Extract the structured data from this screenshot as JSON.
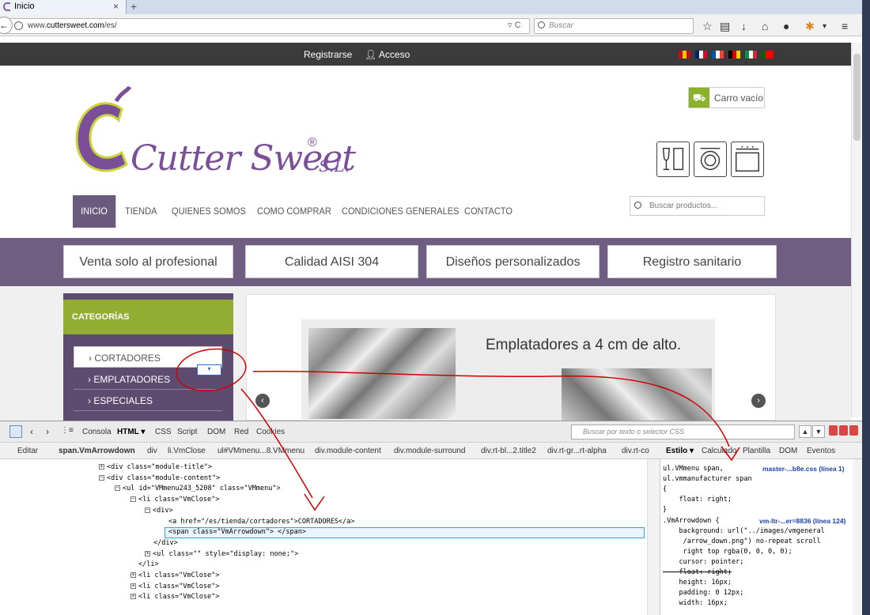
{
  "browser": {
    "tab_title": "Inicio",
    "tab_close": "×",
    "new_tab": "+",
    "url_prefix": "www.",
    "url_host": "cuttersweet.com",
    "url_path": "/es/",
    "search_placeholder": "Buscar",
    "toolbar_icons": [
      "star-icon",
      "clipboard-icon",
      "download-icon",
      "home-icon",
      "chat-icon",
      "extension-icon",
      "menu-icon"
    ]
  },
  "site": {
    "topbar": {
      "register": "Registrarse",
      "login": "Acceso"
    },
    "flags": [
      {
        "name": "spanish-flag",
        "colors": [
          "#c60b1e",
          "#ffc400",
          "#c60b1e"
        ]
      },
      {
        "name": "uk-flag",
        "colors": [
          "#012169",
          "#ffffff",
          "#c8102e"
        ]
      },
      {
        "name": "french-flag",
        "colors": [
          "#0055a4",
          "#ffffff",
          "#ef4135"
        ]
      },
      {
        "name": "german-flag",
        "colors": [
          "#000000",
          "#dd0000",
          "#ffce00"
        ]
      },
      {
        "name": "italian-flag",
        "colors": [
          "#009246",
          "#ffffff",
          "#ce2b37"
        ]
      },
      {
        "name": "portuguese-flag",
        "colors": [
          "#006600",
          "#ff0000",
          "#ff0000"
        ]
      }
    ],
    "logo": {
      "text": "Cutter Sweet",
      "registered": "®",
      "suffix": "S.L."
    },
    "cart": {
      "label": "Carro vacío"
    },
    "menu": [
      {
        "label": "INICIO",
        "active": true
      },
      {
        "label": "TIENDA"
      },
      {
        "label": "QUIENES SOMOS"
      },
      {
        "label": "COMO COMPRAR"
      },
      {
        "label": "CONDICIONES GENERALES"
      },
      {
        "label": "CONTACTO"
      }
    ],
    "product_search_placeholder": "Buscar productos...",
    "features": [
      "Venta solo al profesional",
      "Calidad AISI 304",
      "Diseños personalizados",
      "Registro sanitario"
    ],
    "categories": {
      "title": "CATEGORÍAS",
      "items": [
        "CORTADORES",
        "EMPLATADORES",
        "ESPECIALES"
      ],
      "arrow_label": "▾"
    },
    "slider": {
      "caption": "Emplatadores a 4 cm de alto.",
      "prev": "‹",
      "next": "›"
    },
    "colors": {
      "brand_purple": "#6f5d82",
      "accent_green": "#93ad32",
      "topbar": "#3b3b3b"
    }
  },
  "devtools": {
    "tabs": [
      "Consola",
      "HTML ▾",
      "CSS",
      "Script",
      "DOM",
      "Red",
      "Cookies"
    ],
    "active_tab": "HTML ▾",
    "search_placeholder": "Buscar por texto o selector CSS",
    "edit_label": "Editar",
    "breadcrumbs": [
      "span.VmArrowdown",
      "div",
      "li.VmClose",
      "ul#VMmenu...8.VMmenu",
      "div.module-content",
      "div.module-surround",
      "div.rt-bl...2.title2",
      "div.rt-gr...rt-alpha",
      "div.rt-co"
    ],
    "side_tabs": [
      "Estilo ▾",
      "Calculado",
      "Plantilla",
      "DOM",
      "Eventos"
    ],
    "html_lines": [
      {
        "indent": 125,
        "exp": "⊞",
        "text": "<div class=\"module-title\">"
      },
      {
        "indent": 125,
        "exp": "⊟",
        "text": "<div class=\"module-content\">"
      },
      {
        "indent": 145,
        "exp": "⊟",
        "text": "<ul id=\"VMmenu243_5208\" class=\"VMmenu\">"
      },
      {
        "indent": 165,
        "exp": "⊟",
        "text": "<li class=\"VmClose\">"
      },
      {
        "indent": 183,
        "exp": "⊟",
        "text": "<div>"
      },
      {
        "indent": 213,
        "exp": "",
        "text": "<a href=\"/es/tienda/cortadores\">CORTADORES</a>"
      },
      {
        "indent": 213,
        "exp": "",
        "text": "<span class=\"VmArrowdown\"> </span>"
      },
      {
        "indent": 194,
        "exp": "",
        "text": "</div>"
      },
      {
        "indent": 183,
        "exp": "⊞",
        "text": "<ul class=\"\" style=\"display: none;\">"
      },
      {
        "indent": 175,
        "exp": "",
        "text": "</li>"
      },
      {
        "indent": 165,
        "exp": "⊞",
        "text": "<li class=\"VmClose\">"
      },
      {
        "indent": 165,
        "exp": "⊞",
        "text": "<li class=\"VmClose\">"
      },
      {
        "indent": 165,
        "exp": "⊞",
        "text": "<li class=\"VmClose\">"
      }
    ],
    "css_rules": [
      {
        "text": "ul.VMmenu span,",
        "source": "master-...b8e.css (línea 1)"
      },
      {
        "text": "ul.vmmanufacturer span"
      },
      {
        "text": "{"
      },
      {
        "text": "    float: right;"
      },
      {
        "text": "}"
      },
      {
        "text": ".VmArrowdown {",
        "source": "vm-ltr-...er=8836 (línea 124)"
      },
      {
        "text": "    background: url(\"../images/vmgeneral"
      },
      {
        "text": "     /arrow_down.png\") no-repeat scroll"
      },
      {
        "text": "     right top rgba(0, 0, 0, 0);"
      },
      {
        "text": "    cursor: pointer;"
      },
      {
        "text": "    float: right;",
        "strike": true
      },
      {
        "text": "    height: 16px;"
      },
      {
        "text": "    padding: 0 12px;"
      },
      {
        "text": "    width: 16px;"
      }
    ]
  }
}
